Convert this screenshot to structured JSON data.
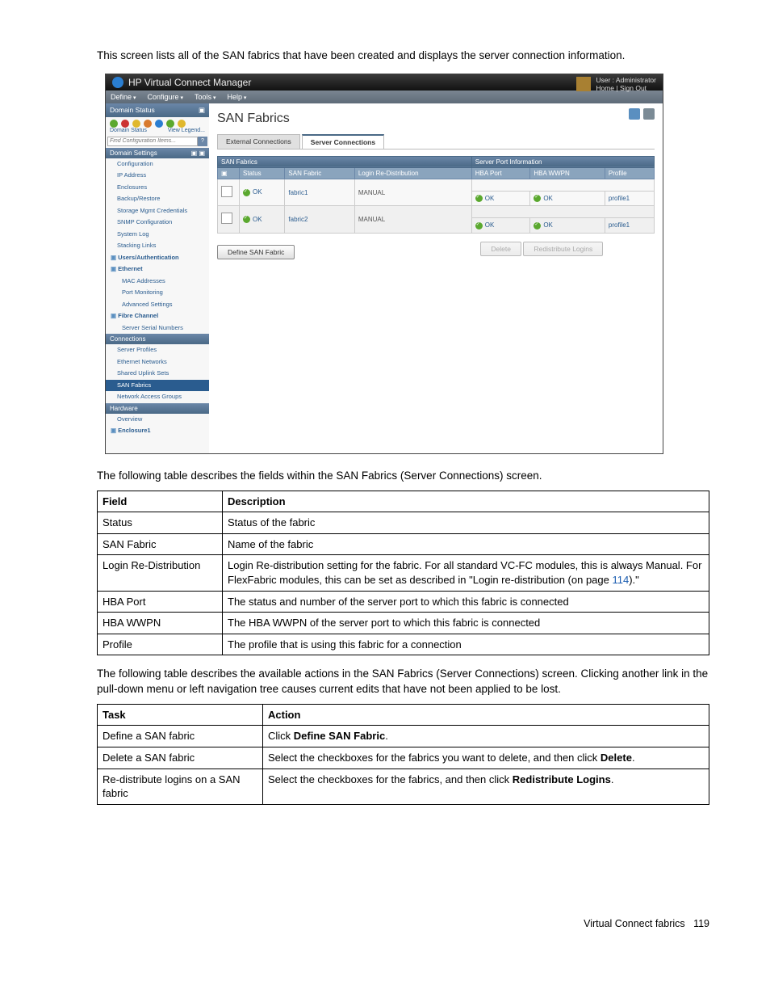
{
  "intro": "This screen lists all of the SAN fabrics that have been created and displays the server connection information.",
  "app": {
    "title": "HP Virtual Connect Manager",
    "user_label": "User : Administrator",
    "user_links": "Home  |  Sign Out",
    "menu": {
      "define": "Define",
      "configure": "Configure",
      "tools": "Tools",
      "help": "Help"
    },
    "sidebar": {
      "domain_status": "Domain Status",
      "labels_left": "Domain Status",
      "view_legend": "View Legend...",
      "search_placeholder": "Find Configuration Items...",
      "domain_settings": "Domain Settings",
      "items": [
        "Configuration",
        "IP Address",
        "Enclosures",
        "Backup/Restore",
        "Storage Mgmt Credentials",
        "SNMP Configuration",
        "System Log",
        "Stacking Links"
      ],
      "users_auth": "Users/Authentication",
      "ethernet": "Ethernet",
      "eth_items": [
        "MAC Addresses",
        "Port Monitoring",
        "Advanced Settings"
      ],
      "fibre_channel": "Fibre Channel",
      "fc_items": [
        "Server Serial Numbers"
      ],
      "connections": "Connections",
      "conn_items": [
        "Server Profiles",
        "Ethernet Networks",
        "Shared Uplink Sets",
        "SAN Fabrics",
        "Network Access Groups"
      ],
      "hardware": "Hardware",
      "hw_items": [
        "Overview"
      ],
      "enclosure": "Enclosure1"
    },
    "heading": "SAN Fabrics",
    "tabs": {
      "external": "External Connections",
      "server": "Server Connections"
    },
    "tbl": {
      "grp1": "SAN Fabrics",
      "grp2": "Server Port Information",
      "h_status": "Status",
      "h_fabric": "SAN Fabric",
      "h_login": "Login Re-Distribution",
      "h_hbaport": "HBA Port",
      "h_hbawwpn": "HBA WWPN",
      "h_profile": "Profile",
      "rows": [
        {
          "status": "OK",
          "fabric": "fabric1",
          "login": "MANUAL",
          "hbaport": "OK",
          "hbawwpn": "OK",
          "profile": "profile1"
        },
        {
          "status": "OK",
          "fabric": "fabric2",
          "login": "MANUAL",
          "hbaport": "OK",
          "hbawwpn": "OK",
          "profile": "profile1"
        }
      ]
    },
    "buttons": {
      "define": "Define SAN Fabric",
      "delete": "Delete",
      "redist": "Redistribute Logins"
    }
  },
  "fields_caption": "The following table describes the fields within the SAN Fabrics (Server Connections) screen.",
  "fields_table": {
    "h1": "Field",
    "h2": "Description",
    "rows": [
      {
        "f": "Status",
        "d": "Status of the fabric"
      },
      {
        "f": "SAN Fabric",
        "d": "Name of the fabric"
      },
      {
        "f": "Login Re-Distribution",
        "d_pre": "Login Re-distribution setting for the fabric. For all standard VC-FC modules, this is always Manual. For FlexFabric modules, this can be set as described in \"Login re-distribution (on page ",
        "link": "114",
        "d_post": ").\""
      },
      {
        "f": "HBA Port",
        "d": "The status and number of the server port to which this fabric is connected"
      },
      {
        "f": "HBA WWPN",
        "d": "The HBA WWPN of the server port to which this fabric is connected"
      },
      {
        "f": "Profile",
        "d": "The profile that is using this fabric for a connection"
      }
    ]
  },
  "actions_caption": "The following table describes the available actions in the SAN Fabrics (Server Connections) screen. Clicking another link in the pull-down menu or left navigation tree causes current edits that have not been applied to be lost.",
  "actions_table": {
    "h1": "Task",
    "h2": "Action",
    "rows": [
      {
        "t": "Define a SAN fabric",
        "a_pre": "Click ",
        "a_bold": "Define SAN Fabric",
        "a_post": "."
      },
      {
        "t": "Delete a SAN fabric",
        "a_pre": "Select the checkboxes for the fabrics you want to delete, and then click ",
        "a_bold": "Delete",
        "a_post": "."
      },
      {
        "t": "Re-distribute logins on a SAN fabric",
        "a_pre": "Select the checkboxes for the fabrics, and then click ",
        "a_bold": "Redistribute Logins",
        "a_post": "."
      }
    ]
  },
  "footer": {
    "label": "Virtual Connect fabrics",
    "page": "119"
  }
}
